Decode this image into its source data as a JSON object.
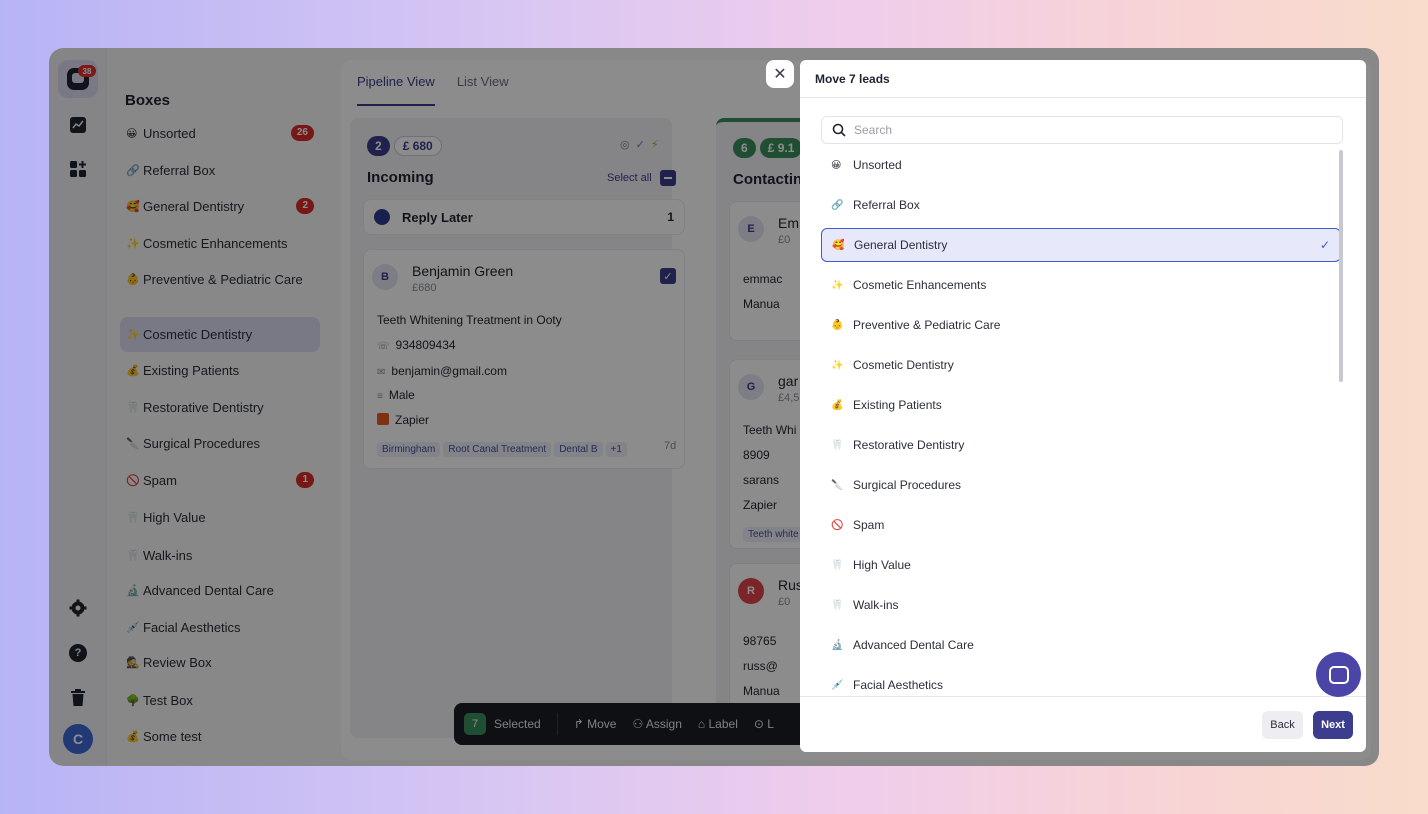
{
  "rail": {
    "badge": "38",
    "avatar": "C",
    "icons": [
      "logo-icon",
      "chart-icon",
      "apps-icon",
      "gear-icon",
      "help-icon",
      "trash-icon"
    ]
  },
  "sidebar": {
    "title": "Boxes",
    "items": [
      {
        "emoji": "😀",
        "label": "Unsorted",
        "count": "26"
      },
      {
        "emoji": "🔗",
        "label": "Referral Box",
        "count": ""
      },
      {
        "emoji": "🥰",
        "label": "General Dentistry",
        "count": "2"
      },
      {
        "emoji": "✨",
        "label": "Cosmetic Enhancements",
        "count": ""
      },
      {
        "emoji": "👶",
        "label": "Preventive & Pediatric Care",
        "count": ""
      },
      {
        "emoji": "✨",
        "label": "Cosmetic Dentistry",
        "count": ""
      },
      {
        "emoji": "💰",
        "label": "Existing Patients",
        "count": ""
      },
      {
        "emoji": "🦷",
        "label": "Restorative Dentistry",
        "count": ""
      },
      {
        "emoji": "🔪",
        "label": "Surgical Procedures",
        "count": ""
      },
      {
        "emoji": "🚫",
        "label": "Spam",
        "count": "1"
      },
      {
        "emoji": "🦷",
        "label": "High Value",
        "count": ""
      },
      {
        "emoji": "🦷",
        "label": "Walk-ins",
        "count": ""
      },
      {
        "emoji": "🔬",
        "label": "Advanced Dental Care",
        "count": ""
      },
      {
        "emoji": "💉",
        "label": "Facial Aesthetics",
        "count": ""
      },
      {
        "emoji": "🕵",
        "label": "Review Box",
        "count": ""
      },
      {
        "emoji": "🌳",
        "label": "Test Box",
        "count": ""
      },
      {
        "emoji": "💰",
        "label": "Some test",
        "count": ""
      }
    ]
  },
  "main": {
    "tabs": [
      {
        "label": "Pipeline View"
      },
      {
        "label": "List View"
      }
    ],
    "incoming": {
      "count": "2",
      "amount": "£ 680",
      "title": "Incoming",
      "select_all": "Select all",
      "reply_later": {
        "label": "Reply Later",
        "count": "1"
      },
      "card": {
        "initial": "B",
        "name": "Benjamin Green",
        "amount": "£680",
        "title": "Teeth Whitening Treatment in Ooty",
        "phone": "934809434",
        "email": "benjamin@gmail.com",
        "gender": "Male",
        "source": "Zapier",
        "tags": [
          "Birmingham",
          "Root Canal Treatment",
          "Dental B",
          "+1"
        ],
        "age": "7d"
      }
    },
    "contacting": {
      "count": "6",
      "amount": "£ 9.1",
      "title": "Contactin",
      "cards": [
        {
          "initial": "E",
          "name": "Em",
          "amount": "£0",
          "line1": "emmac",
          "line2": "Manua"
        },
        {
          "initial": "G",
          "name": "gar",
          "amount": "£4,5",
          "line1": "Teeth Whi",
          "line2": "8909",
          "line3": "sarans",
          "line4": "Zapier",
          "tag": "Teeth white"
        },
        {
          "initial": "R",
          "name": "Rus",
          "amount": "£0",
          "line1": "98765",
          "line2": "russ@",
          "line3": "Manua"
        }
      ]
    },
    "bottom_bar": {
      "count": "7",
      "selected": "Selected",
      "move": "Move",
      "assign": "Assign",
      "label": "Label",
      "more": "L"
    }
  },
  "modal": {
    "title": "Move 7 leads",
    "search_placeholder": "Search",
    "selected_option": "General Dentistry",
    "options": [
      {
        "emoji": "😀",
        "label": "Unsorted"
      },
      {
        "emoji": "🔗",
        "label": "Referral Box"
      },
      {
        "emoji": "🥰",
        "label": "General Dentistry"
      },
      {
        "emoji": "✨",
        "label": "Cosmetic Enhancements"
      },
      {
        "emoji": "👶",
        "label": "Preventive & Pediatric Care"
      },
      {
        "emoji": "✨",
        "label": "Cosmetic Dentistry"
      },
      {
        "emoji": "💰",
        "label": "Existing Patients"
      },
      {
        "emoji": "🦷",
        "label": "Restorative Dentistry"
      },
      {
        "emoji": "🔪",
        "label": "Surgical Procedures"
      },
      {
        "emoji": "🚫",
        "label": "Spam"
      },
      {
        "emoji": "🦷",
        "label": "High Value"
      },
      {
        "emoji": "🦷",
        "label": "Walk-ins"
      },
      {
        "emoji": "🔬",
        "label": "Advanced Dental Care"
      },
      {
        "emoji": "💉",
        "label": "Facial Aesthetics"
      }
    ],
    "back_label": "Back",
    "next_label": "Next"
  },
  "colors": {
    "accent": "#3d3d8f",
    "selected_border": "#3f5bd0",
    "badge_red": "#d92d2a",
    "green": "#3a8f5b"
  }
}
